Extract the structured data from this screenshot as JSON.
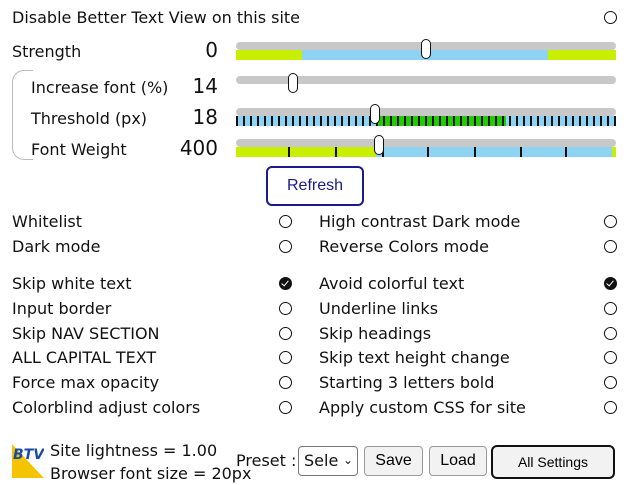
{
  "header": {
    "disable_label": "Disable Better Text View on this site"
  },
  "sliders": {
    "strength": {
      "label": "Strength",
      "value": "0",
      "position": 0.5
    },
    "increase_font": {
      "label": "Increase font (%)",
      "value": "14",
      "position": 0.15
    },
    "threshold": {
      "label": "Threshold (px)",
      "value": "18",
      "position": 0.36
    },
    "font_weight": {
      "label": "Font Weight",
      "value": "400",
      "position": 0.375
    }
  },
  "refresh_label": "Refresh",
  "options": {
    "whitelist": {
      "label": "Whitelist",
      "checked": false
    },
    "high_contrast_dark": {
      "label": "High contrast Dark mode",
      "checked": false
    },
    "dark_mode": {
      "label": "Dark mode",
      "checked": false
    },
    "reverse_colors": {
      "label": "Reverse Colors mode",
      "checked": false
    },
    "skip_white_text": {
      "label": "Skip white text",
      "checked": true
    },
    "avoid_colorful_text": {
      "label": "Avoid colorful text",
      "checked": true
    },
    "input_border": {
      "label": "Input border",
      "checked": false
    },
    "underline_links": {
      "label": "Underline links",
      "checked": false
    },
    "skip_nav": {
      "label": "Skip NAV SECTION",
      "checked": false
    },
    "skip_headings": {
      "label": "Skip headings",
      "checked": false
    },
    "all_capital": {
      "label": "ALL CAPITAL TEXT",
      "checked": false
    },
    "skip_text_height": {
      "label": "Skip text height change",
      "checked": false
    },
    "force_max_opacity": {
      "label": "Force max opacity",
      "checked": false
    },
    "starting_bold": {
      "label": "Starting 3 letters bold",
      "checked": false
    },
    "colorblind": {
      "label": "Colorblind adjust colors",
      "checked": false
    },
    "custom_css": {
      "label": "Apply custom CSS for site",
      "checked": false
    }
  },
  "footer": {
    "logo_text": "BTV",
    "site_lightness": "Site lightness = 1.00",
    "browser_font_size": "Browser font size = 20px",
    "preset_label": "Preset :",
    "preset_value": "Sele",
    "save_label": "Save",
    "load_label": "Load",
    "all_settings_label": "All Settings"
  },
  "colors": {
    "lime": "#c8ee00",
    "sky": "#8fd3f4",
    "green": "#22cc00",
    "blue_dark": "#1a1a8a"
  }
}
